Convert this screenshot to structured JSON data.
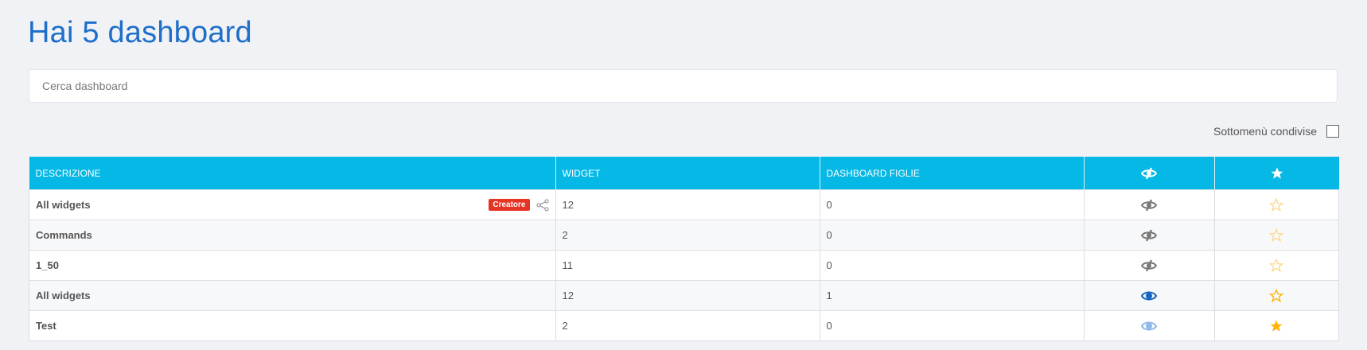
{
  "title": "Hai 5 dashboard",
  "search": {
    "placeholder": "Cerca dashboard",
    "value": ""
  },
  "shared_submenus": {
    "label": "Sottomenù condivise",
    "checked": false
  },
  "table": {
    "headers": [
      "DESCRIZIONE",
      "WIDGET",
      "DASHBOARD FIGLIE"
    ],
    "header_icons": [
      "eye-slash-icon",
      "star-icon"
    ],
    "rows": [
      {
        "name": "All widgets",
        "badge": "Creatore",
        "widget": "12",
        "children": "0",
        "visibility": "hidden",
        "favorite": "empty-light"
      },
      {
        "name": "Commands",
        "widget": "2",
        "children": "0",
        "visibility": "hidden",
        "favorite": "empty-light"
      },
      {
        "name": "1_50",
        "widget": "11",
        "children": "0",
        "visibility": "hidden",
        "favorite": "empty-light"
      },
      {
        "name": "All widgets",
        "widget": "12",
        "children": "1",
        "visibility": "visible",
        "favorite": "empty"
      },
      {
        "name": "Test",
        "widget": "2",
        "children": "0",
        "visibility": "visible-light",
        "favorite": "filled"
      }
    ]
  },
  "colors": {
    "accent": "#05b8e6",
    "title": "#1e6fc9",
    "badge": "#e53324",
    "star": "#ffb400",
    "eye": "#1565c0"
  }
}
